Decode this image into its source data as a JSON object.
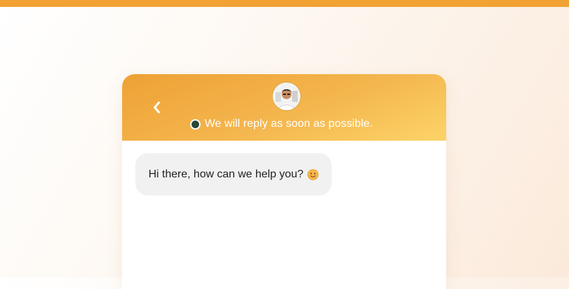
{
  "chat": {
    "status_text": "We will reply as soon as possible.",
    "message_text": "Hi there, how can we help you?",
    "status_color": "#29463a",
    "header_gradient": [
      "#eea135",
      "#fcd468"
    ],
    "accent_color": "#f2a233",
    "icons": {
      "back": "chevron-left-icon",
      "emoji": "smiling-face-icon",
      "avatar": "agent-avatar"
    }
  }
}
